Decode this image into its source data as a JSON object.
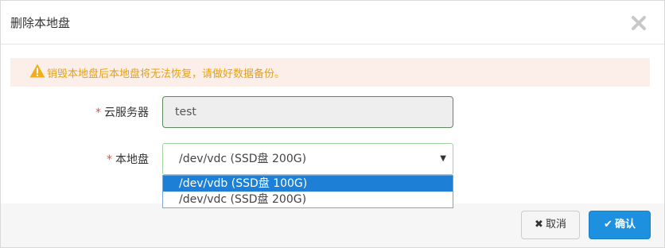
{
  "dialog": {
    "title": "删除本地盘",
    "close_icon": "close-icon"
  },
  "alert": {
    "icon": "warning-icon",
    "text": "销毁本地盘后本地盘将无法恢复，请做好数据备份。",
    "color": "#e4a016"
  },
  "form": {
    "required_mark": "*",
    "server": {
      "label": "云服务器",
      "value": "test"
    },
    "disk": {
      "label": "本地盘",
      "selected": "/dev/vdc (SSD盘 200G)",
      "arrow_icon": "caret-down-icon",
      "options": [
        {
          "label": "/dev/vdb (SSD盘 100G)",
          "highlighted": true
        },
        {
          "label": "/dev/vdc (SSD盘 200G)",
          "highlighted": false
        }
      ]
    }
  },
  "buttons": {
    "cancel": {
      "label": "取消",
      "icon": "times-icon"
    },
    "confirm": {
      "label": "确认",
      "icon": "check-icon"
    }
  },
  "colors": {
    "accent": "#1e90e0",
    "option_highlight": "#1e7fd6",
    "required": "#e74c3c",
    "alert_bg": "#fcefe9"
  }
}
